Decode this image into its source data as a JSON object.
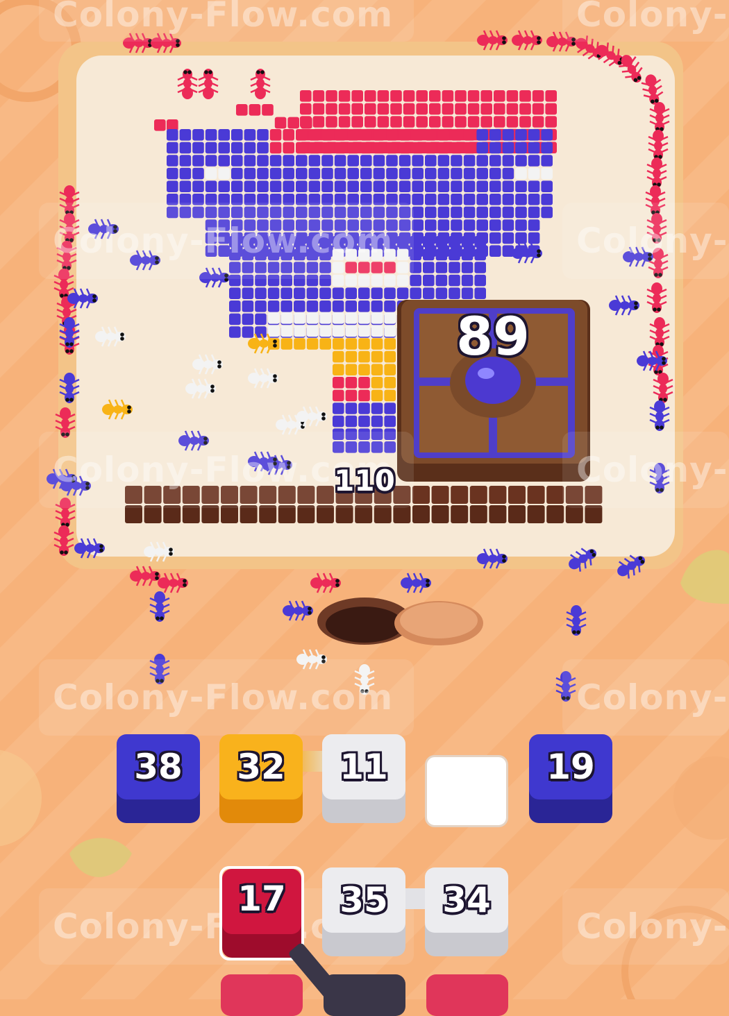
{
  "watermark": {
    "text": "Colony-Flow.com",
    "partial": "Colony-"
  },
  "board": {
    "chest_count": "89",
    "wall_count": "110"
  },
  "queue": {
    "row1": [
      {
        "count": "38",
        "color": "#3b35c8"
      },
      {
        "count": "32",
        "color": "#f6a417"
      },
      {
        "count": "11",
        "color": "#e7e7ea"
      },
      {
        "count": "",
        "color": "#ffffff"
      },
      {
        "count": "19",
        "color": "#3b35c8"
      }
    ],
    "row2": [
      {
        "count": "17",
        "color": "#c8143c"
      },
      {
        "count": "35",
        "color": "#e7e7ea"
      },
      {
        "count": "34",
        "color": "#e7e7ea"
      }
    ]
  },
  "colors": {
    "purple": "#4a3ad6",
    "red": "#ec2b58",
    "white": "#f3f3f3",
    "yellow": "#f8b316",
    "chocolate": "#6a3320",
    "board": "#f7e9d6",
    "background": "#f7b27a"
  }
}
